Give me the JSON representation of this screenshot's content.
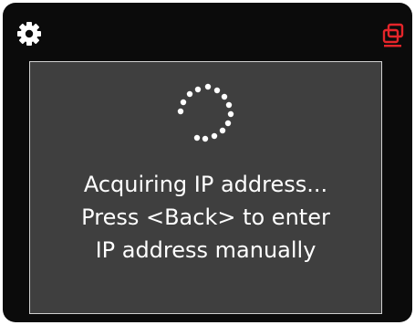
{
  "header": {
    "settings_icon": "gear-icon",
    "network_icon": "network-icon",
    "network_icon_color": "#e4252a"
  },
  "dialog": {
    "spinner_icon": "loading-spinner-icon",
    "lines": [
      "Acquiring IP address...",
      "Press <Back> to enter",
      "IP address manually"
    ]
  },
  "colors": {
    "background": "#0b0b0b",
    "dialog_background": "#3f3f3f",
    "dialog_border": "#d0d0d0",
    "text": "#ffffff",
    "accent_red": "#e4252a"
  }
}
